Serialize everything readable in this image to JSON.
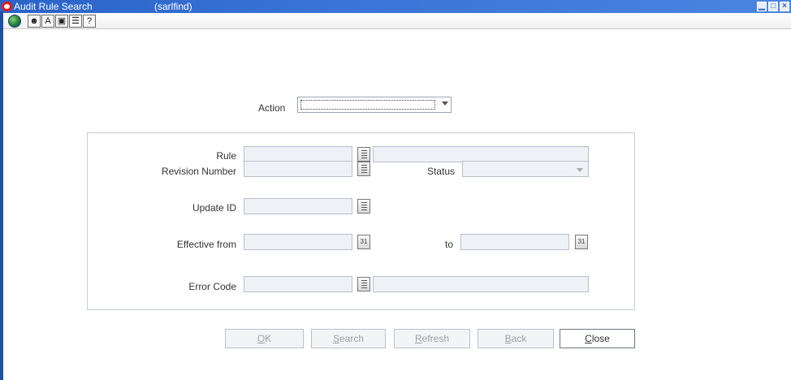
{
  "window": {
    "title": "Audit Rule Search",
    "subtitle": "(sarlfind)",
    "controls": {
      "minimize": "▁",
      "maximize": "□",
      "close": "×"
    }
  },
  "toolbar": {
    "icons": [
      "globe-icon",
      "exit-icon",
      "text-size-icon",
      "window-icon",
      "notes-icon",
      "help-icon"
    ],
    "glyphs": {
      "exit": "☻",
      "text": "A",
      "window": "▣",
      "notes": "☰",
      "help": "?"
    }
  },
  "form": {
    "action_label": "Action",
    "action_value": "",
    "rule_label": "Rule",
    "rule_value": "",
    "rule_desc": "",
    "revision_label": "Revision Number",
    "revision_value": "",
    "status_label": "Status",
    "status_value": "",
    "update_label": "Update ID",
    "update_value": "",
    "effective_label": "Effective from",
    "effective_value": "",
    "to_label": "to",
    "to_value": "",
    "error_label": "Error Code",
    "error_value": "",
    "error_desc": "",
    "calendar_glyph": "31"
  },
  "buttons": {
    "ok": {
      "first": "O",
      "rest": "K"
    },
    "search": {
      "first": "S",
      "rest": "earch"
    },
    "refresh": {
      "first": "R",
      "rest": "efresh"
    },
    "back": {
      "first": "B",
      "rest": "ack"
    },
    "close": {
      "first": "C",
      "rest": "lose"
    }
  },
  "colors": {
    "titlebar": "#2a63c8",
    "field_bg": "#eef1f6",
    "logo_red": "#e21b1b"
  }
}
